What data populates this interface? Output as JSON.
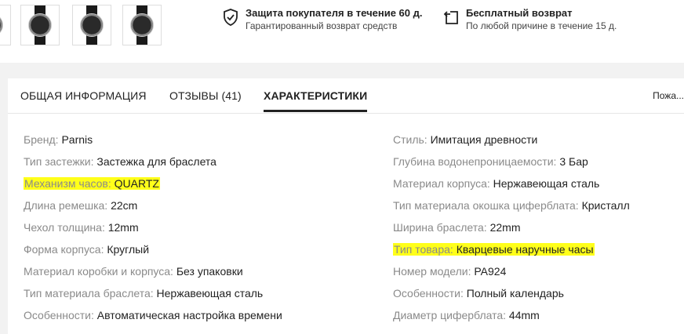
{
  "protection": {
    "title": "Защита покупателя в течение 60 д.",
    "subtitle": "Гарантированный возврат средств",
    "icon": "shield-check-icon"
  },
  "returns": {
    "title": "Бесплатный возврат",
    "subtitle": "По любой причине в течение 15 д.",
    "icon": "return-box-icon"
  },
  "tabs": [
    {
      "label": "ОБЩАЯ ИНФОРМАЦИЯ",
      "active": false
    },
    {
      "label": "ОТЗЫВЫ (41)",
      "active": false
    },
    {
      "label": "ХАРАКТЕРИСТИКИ",
      "active": true
    }
  ],
  "more_label": "Пожа...",
  "specs_left": [
    {
      "key": "Бренд:",
      "value": "Parnis",
      "highlight": false
    },
    {
      "key": "Тип застежки:",
      "value": "Застежка для браслета",
      "highlight": false
    },
    {
      "key": "Механизм часов:",
      "value": "QUARTZ",
      "highlight": true
    },
    {
      "key": "Длина ремешка:",
      "value": "22cm",
      "highlight": false
    },
    {
      "key": "Чехол толщина:",
      "value": "12mm",
      "highlight": false
    },
    {
      "key": "Форма корпуса:",
      "value": "Круглый",
      "highlight": false
    },
    {
      "key": "Материал коробки и корпуса:",
      "value": "Без упаковки",
      "highlight": false
    },
    {
      "key": "Тип материала браслета:",
      "value": "Нержавеющая сталь",
      "highlight": false
    },
    {
      "key": "Особенности:",
      "value": "Автоматическая настройка времени",
      "highlight": false
    }
  ],
  "specs_right": [
    {
      "key": "Стиль:",
      "value": "Имитация древности",
      "highlight": false
    },
    {
      "key": "Глубина водонепроницаемости:",
      "value": "3 Бар",
      "highlight": false
    },
    {
      "key": "Материал корпуса:",
      "value": "Нержавеющая сталь",
      "highlight": false
    },
    {
      "key": "Тип материала окошка циферблата:",
      "value": "Кристалл",
      "highlight": false
    },
    {
      "key": "Ширина браслета:",
      "value": "22mm",
      "highlight": false
    },
    {
      "key": "Тип товара:",
      "value": "Кварцевые наручные часы",
      "highlight": true
    },
    {
      "key": "Номер модели:",
      "value": "PA924",
      "highlight": false
    },
    {
      "key": "Особенности:",
      "value": "Полный календарь",
      "highlight": false
    },
    {
      "key": "Диаметр циферблата:",
      "value": "44mm",
      "highlight": false
    }
  ],
  "colors": {
    "highlight": "#ffff1a",
    "key_text": "#8a8a8a",
    "value_text": "#222222"
  }
}
